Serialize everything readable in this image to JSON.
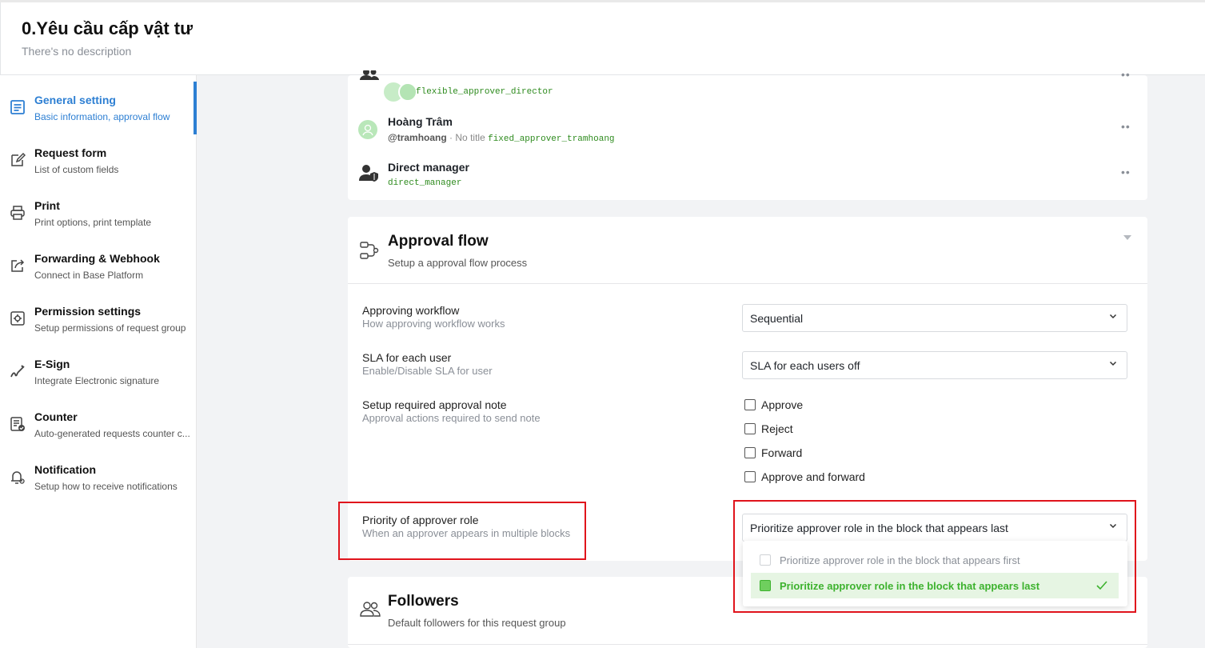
{
  "header": {
    "title": "0.Yêu cầu cấp vật tư",
    "description": "There's no description"
  },
  "sidebar": {
    "items": [
      {
        "label": "General setting",
        "sub": "Basic information, approval flow",
        "icon": "document-list-icon",
        "active": true
      },
      {
        "label": "Request form",
        "sub": "List of custom fields",
        "icon": "edit-icon"
      },
      {
        "label": "Print",
        "sub": "Print options, print template",
        "icon": "printer-icon"
      },
      {
        "label": "Forwarding & Webhook",
        "sub": "Connect in Base Platform",
        "icon": "share-icon"
      },
      {
        "label": "Permission settings",
        "sub": "Setup permissions of request group",
        "icon": "gear-icon"
      },
      {
        "label": "E-Sign",
        "sub": "Integrate Electronic signature",
        "icon": "signature-icon"
      },
      {
        "label": "Counter",
        "sub": "Auto-generated requests counter c...",
        "icon": "counter-icon"
      },
      {
        "label": "Notification",
        "sub": "Setup how to receive notifications",
        "icon": "bell-icon"
      }
    ]
  },
  "approvers": [
    {
      "name": "",
      "handle": "",
      "title": "",
      "code": "flexible_approver_director",
      "icon": "group-icon"
    },
    {
      "name": "Hoàng Trâm",
      "handle": "@tramhoang",
      "title": "No title",
      "code": "fixed_approver_tramhoang",
      "icon": "avatar"
    },
    {
      "name": "Direct manager",
      "handle": "",
      "title": "",
      "code": "direct_manager",
      "icon": "manager-icon"
    }
  ],
  "approval_flow": {
    "title": "Approval flow",
    "subtitle": "Setup a approval flow process",
    "workflow": {
      "label": "Approving workflow",
      "sub": "How approving workflow works",
      "value": "Sequential"
    },
    "sla": {
      "label": "SLA for each user",
      "sub": "Enable/Disable SLA for user",
      "value": "SLA for each users off"
    },
    "note": {
      "label": "Setup required approval note",
      "sub": "Approval actions required to send note",
      "options": [
        "Approve",
        "Reject",
        "Forward",
        "Approve and forward"
      ]
    },
    "priority": {
      "label": "Priority of approver role",
      "sub": "When an approver appears in multiple blocks",
      "value": "Prioritize approver role in the block that appears last",
      "options": [
        "Prioritize approver role in the block that appears first",
        "Prioritize approver role in the block that appears last"
      ],
      "selected_index": 1
    }
  },
  "followers": {
    "title": "Followers",
    "subtitle": "Default followers for this request group"
  },
  "colors": {
    "accent": "#2d7fd3",
    "green": "#3db22e",
    "highlight": "#e0141c"
  }
}
